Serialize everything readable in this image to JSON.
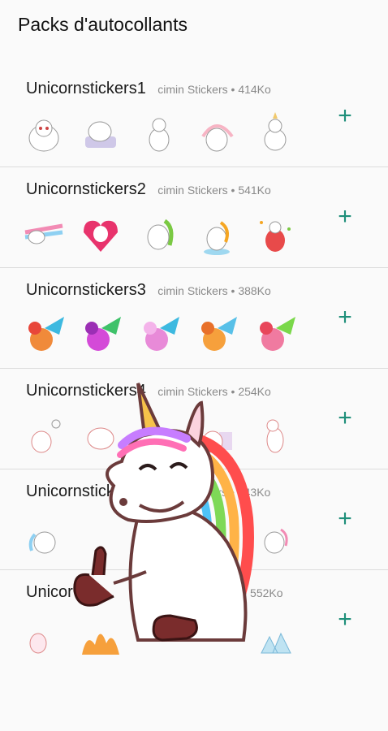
{
  "header": {
    "title": "Packs d'autocollants"
  },
  "packs": [
    {
      "name": "Unicornstickers1",
      "publisher": "cimin Stickers",
      "size": "414Ko"
    },
    {
      "name": "Unicornstickers2",
      "publisher": "cimin Stickers",
      "size": "541Ko"
    },
    {
      "name": "Unicornstickers3",
      "publisher": "cimin Stickers",
      "size": "388Ko"
    },
    {
      "name": "Unicornstickers4",
      "publisher": "cimin Stickers",
      "size": "254Ko"
    },
    {
      "name": "Unicornsticke",
      "publisher": "rs",
      "size": "343Ko"
    },
    {
      "name": "Unicor",
      "publisher": "",
      "size": "552Ko"
    }
  ],
  "add_label": "+",
  "colors": {
    "accent": "#1f8f7a"
  },
  "icons": {
    "add": "plus-icon"
  }
}
